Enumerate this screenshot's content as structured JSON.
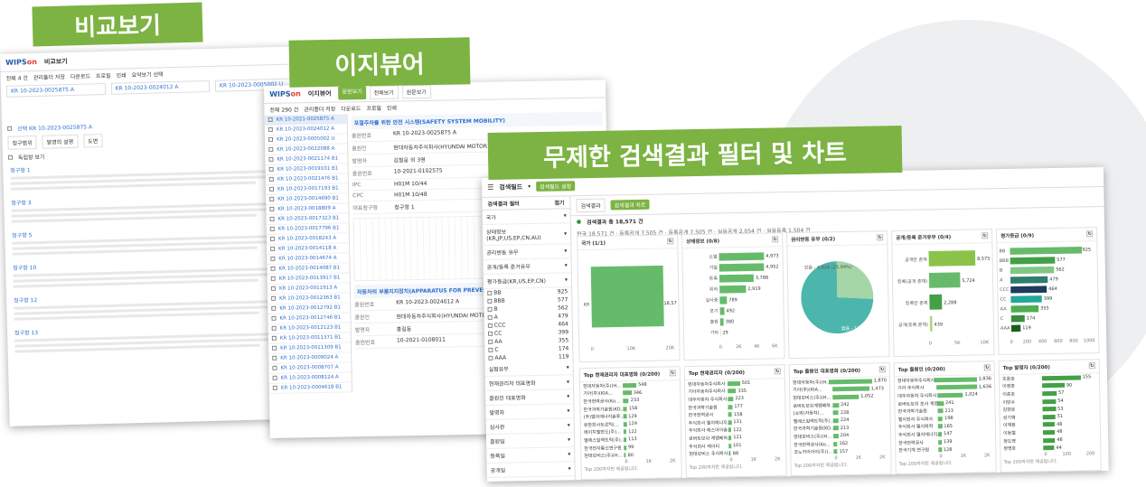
{
  "titles": {
    "compare": "비교보기",
    "easyview": "이지뷰어",
    "chart": "무제한 검색결과 필터 및 차트"
  },
  "logo": "WIPS",
  "compare": {
    "app_title": "비교보기",
    "toolbar": [
      "전체 4 건",
      "관리폴더 저장",
      "다운로드",
      "프로필",
      "인쇄",
      "요약보기 선택"
    ],
    "patents": [
      "KR 10-2023-0025875 A",
      "KR 10-2023-0024012 A",
      "KR 10-2023-0005002 U",
      "KR 10-2023-0001959 A"
    ],
    "selected_label": "선택 KR 10-2023-0025875 A",
    "subtabs": [
      "청구범위",
      "발명의 설명",
      "도면"
    ],
    "section": "독립항 보기",
    "claims": [
      "청구항 1",
      "청구항 3",
      "청구항 5",
      "청구항 10",
      "청구항 12",
      "청구항 13"
    ]
  },
  "easy": {
    "app_title": "이지뷰어",
    "tabs": [
      "문헌보기",
      "전체보기",
      "원문보기"
    ],
    "toolbar": [
      "전체 290 건",
      "관리폴더 저장",
      "다운로드",
      "프로필",
      "인쇄"
    ],
    "list": [
      "KR 10-2021-0025875 A",
      "KR 10-2023-0024012 A",
      "KR 20-2023-0005002 U",
      "KR 10-2023-0022088 A",
      "KR 10-2023-0021174 B1",
      "KR 10-2023-0019101 B1",
      "KR 10-2023-0021476 B1",
      "KR 10-2023-0017193 B1",
      "KR 10-2023-0014690 B1",
      "KR 10-2023-0018809 A",
      "KR 10-2023-0017323 B1",
      "KR 10-2023-0017796 B1",
      "KR 10-2023-0018243 A",
      "KR 10-2023-0014118 A",
      "KR 10-2023-0014674 A",
      "KR 10-2023-0014087 B1",
      "KR 10-2023-0013917 B1",
      "KR 10-2023-0011913 A",
      "KR 10-2023-0012363 B1",
      "KR 10-2023-0012792 B1",
      "KR 10-2023-0012746 B1",
      "KR 10-2023-0012123 B1",
      "KR 10-2023-0011371 B1",
      "KR 10-2023-0011309 B1",
      "KR 10-2023-0009024 A",
      "KR 10-2023-0008707 A",
      "KR 10-2023-0008124 A",
      "KR 10-2023-0004618 B1"
    ],
    "title_bar": "포절주차를 위한 안전 시스템(SAFETY SYSTEM MOBILITY)",
    "fields": [
      [
        "출원번호",
        "KR 10-2023-0025875 A"
      ],
      [
        "출원인",
        "현대자동차주식회사(HYUNDAI MOTOR COMPANY)"
      ],
      [
        "발명자",
        "김철웅 외 3명"
      ],
      [
        "출원번호",
        "10-2021-0102575"
      ],
      [
        "IPC",
        "H01M 10/44"
      ],
      [
        "CPC",
        "H01M 10/48"
      ],
      [
        "대표청구항",
        "청구항 1"
      ]
    ],
    "second_title": "자동차의 부품지지장치(APPARATUS FOR PREVENTING FIRE OF VEHICLE)",
    "second_fields": [
      [
        "출원번호",
        "KR 10-2023-0024012 A"
      ],
      [
        "출원인",
        "현대자동차주식회사(HYUNDAI MOTOR COMPANY)"
      ],
      [
        "발명자",
        "홍길동"
      ],
      [
        "출원번호",
        "10-2021-0108011"
      ]
    ]
  },
  "chart_screen": {
    "field_select": "검색필드",
    "save_btn": "검색필드 설정",
    "filter_header": "검색결과 필터",
    "filter_fold": "접기",
    "tabs": [
      "검색결과",
      "검색결과 차트"
    ],
    "result_count": "검색결과 총 18,571 건",
    "country_counts": "한국 18,571 건 · 등록공개 7,505 건 · 등록공개 7,505 건 · 실용공개 2,054 건 · 실용등록 1,504 건",
    "filters": [
      "국가",
      "상태정보(KR,JP,US,EP,CN,AU)",
      "권리변동 유무",
      "공개/등록 준거유무",
      "평가등급(KR,US,EP,CN)",
      "실험유무",
      "현재권리자 대표명화",
      "출원인 대표명화",
      "발명자",
      "심사관",
      "출원일",
      "등록일",
      "공개일",
      "출원인 코드",
      "가중치"
    ],
    "grades": [
      [
        "BB",
        "925"
      ],
      [
        "BBB",
        "577"
      ],
      [
        "B",
        "562"
      ],
      [
        "A",
        "479"
      ],
      [
        "CCC",
        "464"
      ],
      [
        "CC",
        "399"
      ],
      [
        "AA",
        "355"
      ],
      [
        "C",
        "174"
      ],
      [
        "AAA",
        "119"
      ]
    ]
  },
  "chart_data": [
    {
      "type": "bar",
      "title": "국가 (1/1)",
      "categories": [
        "KR"
      ],
      "values": [
        18571
      ],
      "xlim": [
        0,
        20000
      ],
      "ticks": [
        "0",
        "10K",
        "20K"
      ]
    },
    {
      "type": "bar",
      "title": "상태정보 (0/8)",
      "categories": [
        "소멸",
        "거절",
        "등록",
        "취하",
        "실사중",
        "포기",
        "출원",
        "기타"
      ],
      "values": [
        4973,
        4952,
        3788,
        2919,
        789,
        492,
        380,
        29
      ],
      "xlim": [
        0,
        6000
      ],
      "ticks": [
        "0",
        "2K",
        "4K",
        "6K"
      ]
    },
    {
      "type": "pie",
      "title": "권리변동 유무 (0/2)",
      "categories": [
        "있음",
        "없음"
      ],
      "labels": [
        "있음 - 4,826 (25.99%)",
        "없음 - 13,745 (74.01%)"
      ],
      "values": [
        4826,
        13745
      ]
    },
    {
      "type": "bar",
      "title": "공개/등록 준거유무 (0/4)",
      "categories": [
        "공개만 존재",
        "등록(공개 존재)",
        "등록만 존재",
        "공개(등록 존재)"
      ],
      "values": [
        8575,
        5724,
        2288,
        439
      ],
      "xlim": [
        0,
        10000
      ],
      "ticks": [
        "0",
        "5K",
        "10K"
      ]
    },
    {
      "type": "bar",
      "title": "평가등급 (0/9)",
      "categories": [
        "BB",
        "BBB",
        "B",
        "A",
        "CCC",
        "CC",
        "AA",
        "C",
        "AAA"
      ],
      "values": [
        925,
        577,
        562,
        479,
        464,
        399,
        355,
        174,
        119
      ],
      "xlim": [
        0,
        1000
      ],
      "ticks": [
        "0",
        "200",
        "400",
        "600",
        "800",
        "1000"
      ]
    }
  ],
  "bottom_panels": [
    {
      "title": "Top 현재권리자 대표명화 (0/200)",
      "rows": [
        [
          "현대자동차(주)(H...",
          "548"
        ],
        [
          "기아(주)(KIA...",
          "346"
        ],
        [
          "한국전력공사(Ko...",
          "233"
        ],
        [
          "한국과학기술원(KO...",
          "158"
        ],
        [
          "(주)엘지에너지솔루...",
          "129"
        ],
        [
          "유한회사트로틱(...",
          "129"
        ],
        [
          "에이치엘만도(주)...",
          "122"
        ],
        [
          "엘에스일렉트릭(주)...",
          "113"
        ],
        [
          "한국전자통신연구원",
          "99"
        ],
        [
          "현대모비스(주)(H...",
          "80"
        ]
      ],
      "ticks": [
        "0",
        "1K",
        "2K"
      ],
      "footer": "Top 200까지만 제공됩니다."
    },
    {
      "title": "Top 현재권리자 (0/200)",
      "rows": [
        [
          "현대자동차주식회사",
          "501"
        ],
        [
          "기아자동차주식회사",
          "335"
        ],
        [
          "대우자동차 주식회사",
          "223"
        ],
        [
          "한국과학기술원",
          "177"
        ],
        [
          "한국전력공사",
          "158"
        ],
        [
          "주식회사 엘지에너지..",
          "131"
        ],
        [
          "주식회사 에스아이솔...",
          "122"
        ],
        [
          "로버트보쉬 게엠베하...",
          "121"
        ],
        [
          "주식회사 케이티",
          "101"
        ],
        [
          "현대모비스 주식회사",
          "88"
        ]
      ],
      "ticks": [
        "0",
        "1K",
        "2K"
      ],
      "footer": "Top 200까지만 제공됩니다."
    },
    {
      "title": "Top 출원인 대표명화 (0/200)",
      "rows": [
        [
          "현대자동차(주)(H...",
          "1,870"
        ],
        [
          "기아(주)(KIA...",
          "1,473"
        ],
        [
          "현대모비스(주)(H...",
          "1,052"
        ],
        [
          "로버트보쉬게엠베하...",
          "242"
        ],
        [
          "(쇼와)자동차(...",
          "228"
        ],
        [
          "엘에스일렉트릭(주)...",
          "224"
        ],
        [
          "한국과학기술원(KO...",
          "213"
        ],
        [
          "현대모비스(주)(H...",
          "204"
        ],
        [
          "한국전력공사(Ko...",
          "162"
        ],
        [
          "코노카이아이(주)(...",
          "157"
        ]
      ],
      "ticks": [
        "0",
        "1K",
        "2K"
      ],
      "footer": "Top 200까지만 제공됩니다."
    },
    {
      "title": "Top 출원인 (0/200)",
      "rows": [
        [
          "현대자동차주식회사",
          "1,836"
        ],
        [
          "기아 주식회사",
          "1,636"
        ],
        [
          "대우자동차 주식회사",
          "1,024"
        ],
        [
          "로버트보쉬 포샤 게엠...",
          "241"
        ],
        [
          "한국과학기술원",
          "213"
        ],
        [
          "엘지전자 주식회사",
          "198"
        ],
        [
          "주식회사 엘지화학",
          "165"
        ],
        [
          "주식회사 엘지에너지...",
          "147"
        ],
        [
          "한국전력공사",
          "139"
        ],
        [
          "한국기계 연구원",
          "128"
        ]
      ],
      "ticks": [
        "0",
        "1K",
        "2K"
      ],
      "footer": "Top 200까지만 제공됩니다."
    },
    {
      "title": "Top 발명자 (0/200)",
      "rows": [
        [
          "조용호",
          "155"
        ],
        [
          "이정훈",
          "90"
        ],
        [
          "이준호",
          "57"
        ],
        [
          "이민수",
          "54"
        ],
        [
          "김현호",
          "53"
        ],
        [
          "성기혁",
          "51"
        ],
        [
          "이재원",
          "48"
        ],
        [
          "이동철",
          "48"
        ],
        [
          "정도영",
          "48"
        ],
        [
          "정영호",
          "44"
        ]
      ],
      "ticks": [
        "0",
        "100",
        "200"
      ],
      "footer": "Top 200까지만 제공됩니다."
    }
  ],
  "colors": {
    "accent": "#7cb342",
    "blue": "#2d6fd1",
    "bar": "#66bb6a",
    "teal": "#2e7d6f",
    "navy": "#1e3a5f"
  }
}
